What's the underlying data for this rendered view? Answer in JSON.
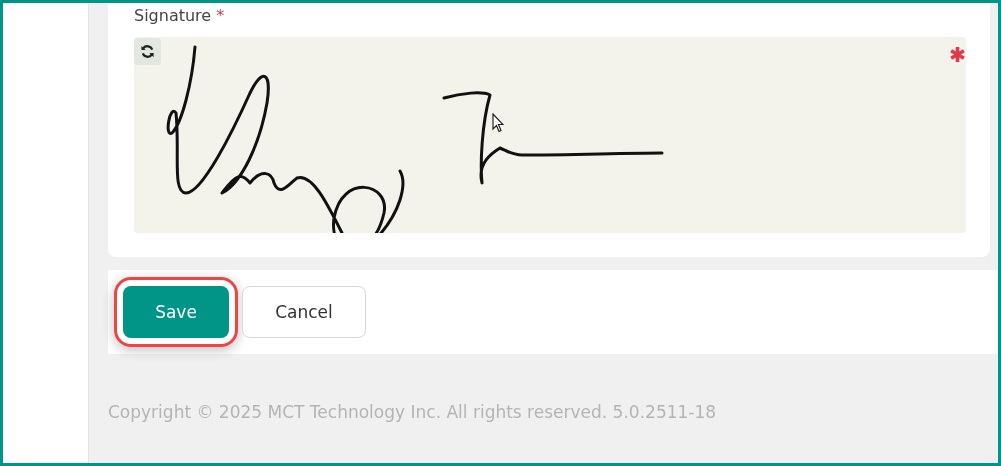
{
  "signature_field": {
    "label": "Signature",
    "required_mark": "*",
    "required": true
  },
  "buttons": [
    {
      "label": "Save",
      "kind": "primary",
      "highlighted": true
    },
    {
      "label": "Cancel",
      "kind": "secondary",
      "highlighted": false
    }
  ],
  "footer": {
    "copyright": "Copyright © 2025 MCT Technology Inc. All rights reserved. 5.0.2511-18"
  }
}
